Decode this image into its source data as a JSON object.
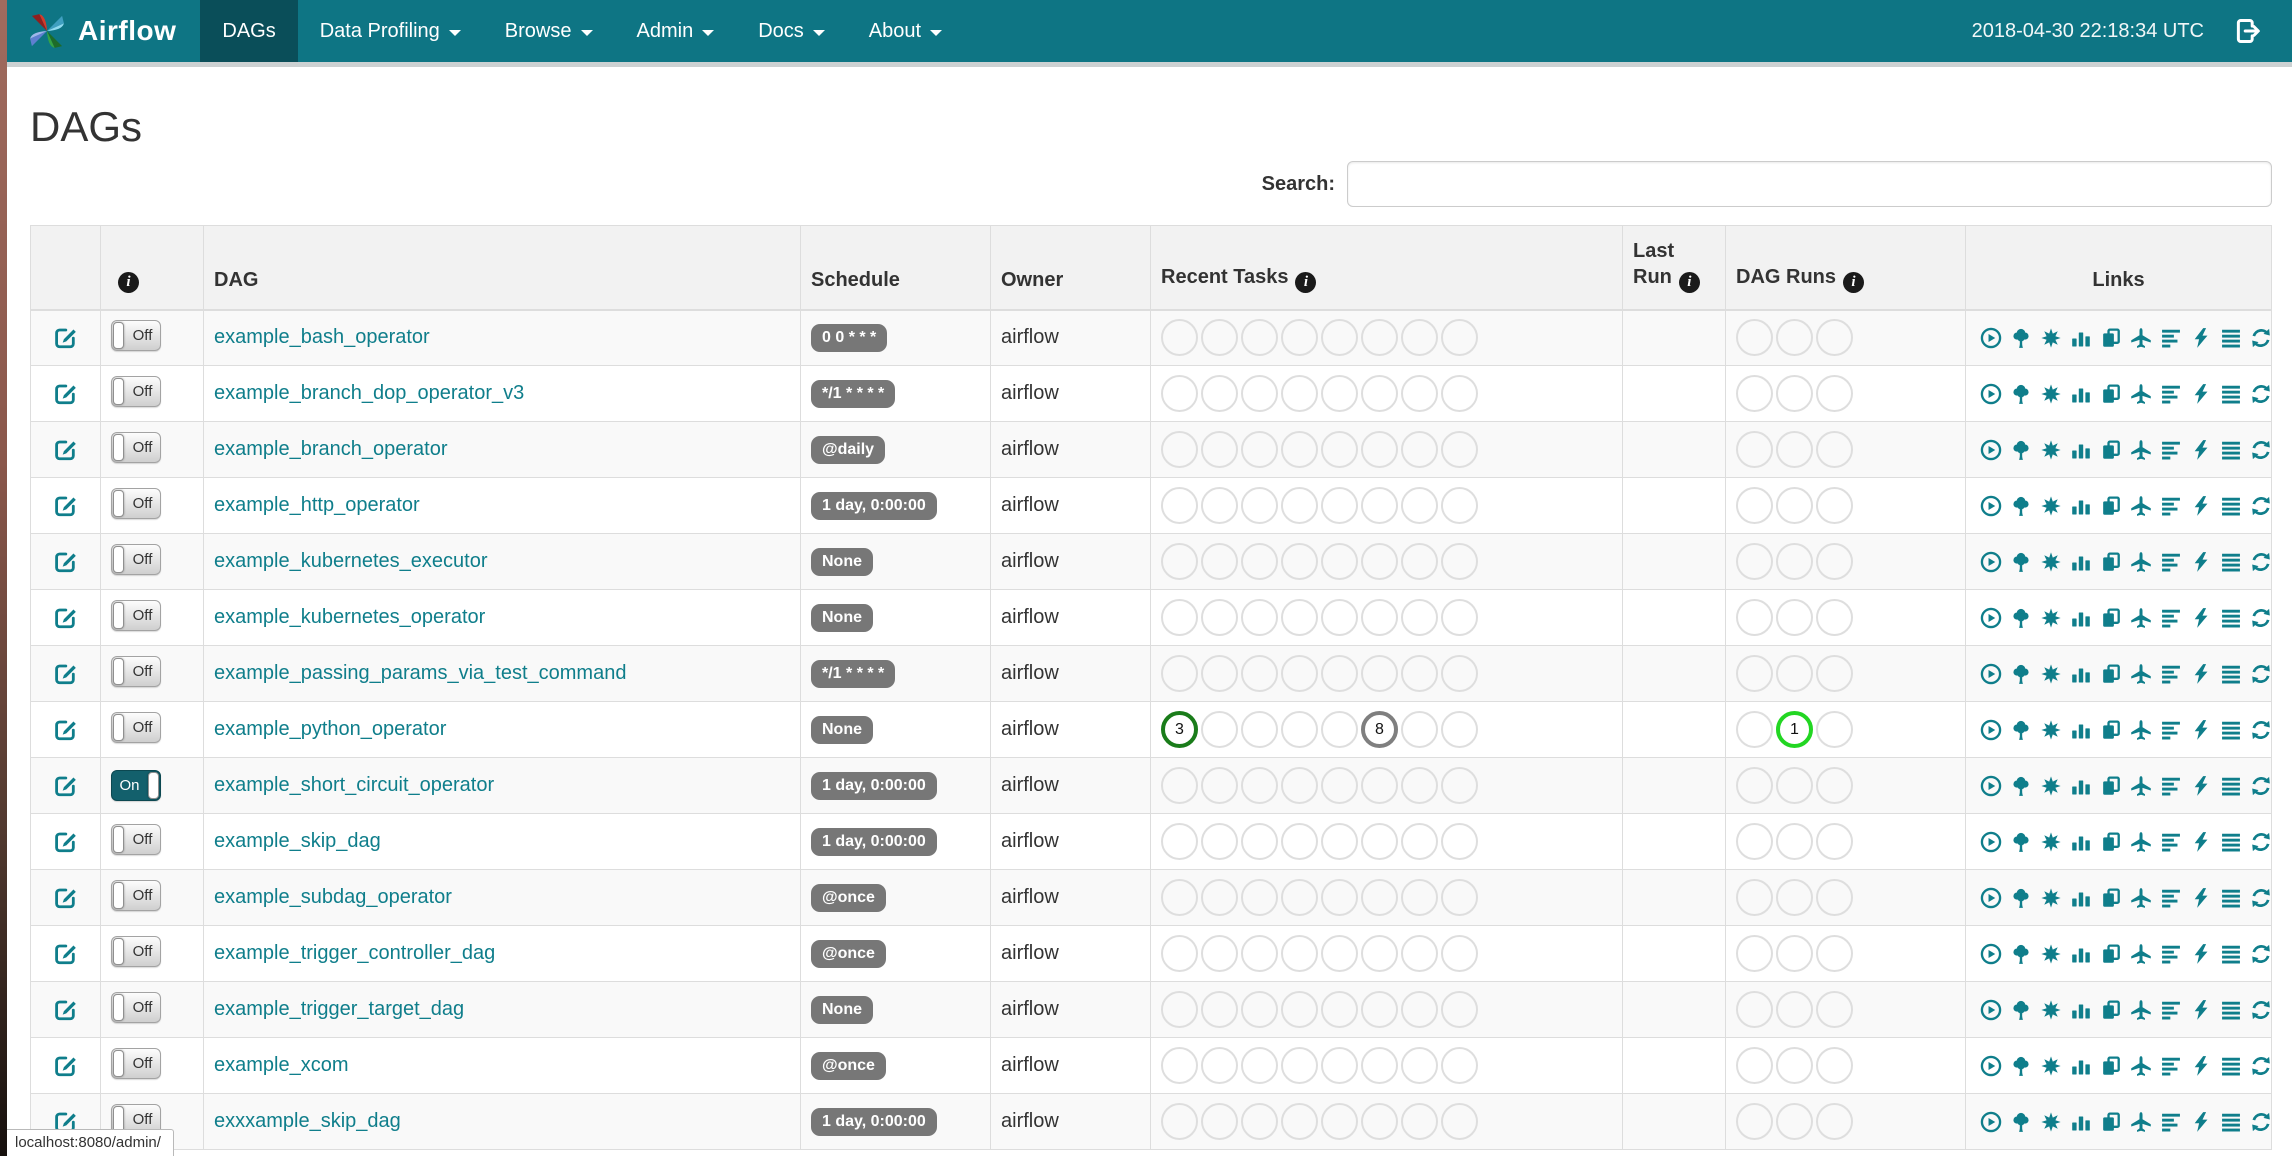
{
  "colors": {
    "navbar_teal": "#0e7584",
    "navbar_active_teal": "#0a4e59",
    "accent_teal": "#0f7e8b",
    "badge_gray": "#777777",
    "success": "#1a7c1a",
    "queued": "#7f7f7f",
    "running": "#22d622",
    "empty_circle_border": "#dedede"
  },
  "navbar": {
    "brand": "Airflow",
    "clock": "2018-04-30 22:18:34 UTC",
    "items": [
      {
        "label": "DAGs",
        "active": true,
        "caret": false
      },
      {
        "label": "Data Profiling",
        "active": false,
        "caret": true
      },
      {
        "label": "Browse",
        "active": false,
        "caret": true
      },
      {
        "label": "Admin",
        "active": false,
        "caret": true
      },
      {
        "label": "Docs",
        "active": false,
        "caret": true
      },
      {
        "label": "About",
        "active": false,
        "caret": true
      }
    ]
  },
  "page": {
    "title": "DAGs",
    "search_label": "Search:",
    "search_value": "",
    "status_bar": "localhost:8080/admin/"
  },
  "icons": {
    "info_glyph": "i"
  },
  "table": {
    "headers": {
      "dag": "DAG",
      "schedule": "Schedule",
      "owner": "Owner",
      "recent_tasks": "Recent Tasks",
      "last_run": "Last Run",
      "dag_runs": "DAG Runs",
      "links": "Links"
    },
    "recent_task_slots": 8,
    "dag_run_slots": 3,
    "links": [
      {
        "name": "play-circle-icon",
        "icon": "play-circle"
      },
      {
        "name": "tree-icon",
        "icon": "tree"
      },
      {
        "name": "sunburst-graph-icon",
        "icon": "sunburst"
      },
      {
        "name": "bar-chart-icon",
        "icon": "bar-chart"
      },
      {
        "name": "copy-pages-icon",
        "icon": "copy"
      },
      {
        "name": "plane-icon",
        "icon": "plane"
      },
      {
        "name": "align-left-gantt-icon",
        "icon": "align-left"
      },
      {
        "name": "lightning-bolt-icon",
        "icon": "bolt"
      },
      {
        "name": "align-justify-icon",
        "icon": "align-justify"
      },
      {
        "name": "refresh-icon",
        "icon": "refresh"
      }
    ],
    "rows": [
      {
        "dag": "example_bash_operator",
        "schedule": "0 0 * * *",
        "owner": "airflow",
        "toggle": "Off",
        "last_run": "",
        "recent_tasks": [],
        "dag_runs": []
      },
      {
        "dag": "example_branch_dop_operator_v3",
        "schedule": "*/1 * * * *",
        "owner": "airflow",
        "toggle": "Off",
        "last_run": "",
        "recent_tasks": [],
        "dag_runs": []
      },
      {
        "dag": "example_branch_operator",
        "schedule": "@daily",
        "owner": "airflow",
        "toggle": "Off",
        "last_run": "",
        "recent_tasks": [],
        "dag_runs": []
      },
      {
        "dag": "example_http_operator",
        "schedule": "1 day, 0:00:00",
        "owner": "airflow",
        "toggle": "Off",
        "last_run": "",
        "recent_tasks": [],
        "dag_runs": []
      },
      {
        "dag": "example_kubernetes_executor",
        "schedule": "None",
        "owner": "airflow",
        "toggle": "Off",
        "last_run": "",
        "recent_tasks": [],
        "dag_runs": []
      },
      {
        "dag": "example_kubernetes_operator",
        "schedule": "None",
        "owner": "airflow",
        "toggle": "Off",
        "last_run": "",
        "recent_tasks": [],
        "dag_runs": []
      },
      {
        "dag": "example_passing_params_via_test_command",
        "schedule": "*/1 * * * *",
        "owner": "airflow",
        "toggle": "Off",
        "last_run": "",
        "recent_tasks": [],
        "dag_runs": []
      },
      {
        "dag": "example_python_operator",
        "schedule": "None",
        "owner": "airflow",
        "toggle": "Off",
        "last_run": "",
        "recent_tasks": [
          {
            "slot": 0,
            "count": "3",
            "color": "success"
          },
          {
            "slot": 5,
            "count": "8",
            "color": "queued"
          }
        ],
        "dag_runs": [
          {
            "slot": 1,
            "count": "1",
            "color": "running"
          }
        ]
      },
      {
        "dag": "example_short_circuit_operator",
        "schedule": "1 day, 0:00:00",
        "owner": "airflow",
        "toggle": "On",
        "last_run": "",
        "recent_tasks": [],
        "dag_runs": []
      },
      {
        "dag": "example_skip_dag",
        "schedule": "1 day, 0:00:00",
        "owner": "airflow",
        "toggle": "Off",
        "last_run": "",
        "recent_tasks": [],
        "dag_runs": []
      },
      {
        "dag": "example_subdag_operator",
        "schedule": "@once",
        "owner": "airflow",
        "toggle": "Off",
        "last_run": "",
        "recent_tasks": [],
        "dag_runs": []
      },
      {
        "dag": "example_trigger_controller_dag",
        "schedule": "@once",
        "owner": "airflow",
        "toggle": "Off",
        "last_run": "",
        "recent_tasks": [],
        "dag_runs": []
      },
      {
        "dag": "example_trigger_target_dag",
        "schedule": "None",
        "owner": "airflow",
        "toggle": "Off",
        "last_run": "",
        "recent_tasks": [],
        "dag_runs": []
      },
      {
        "dag": "example_xcom",
        "schedule": "@once",
        "owner": "airflow",
        "toggle": "Off",
        "last_run": "",
        "recent_tasks": [],
        "dag_runs": []
      },
      {
        "dag": "exxxample_skip_dag",
        "schedule": "1 day, 0:00:00",
        "owner": "airflow",
        "toggle": "Off",
        "last_run": "",
        "recent_tasks": [],
        "dag_runs": []
      }
    ]
  }
}
